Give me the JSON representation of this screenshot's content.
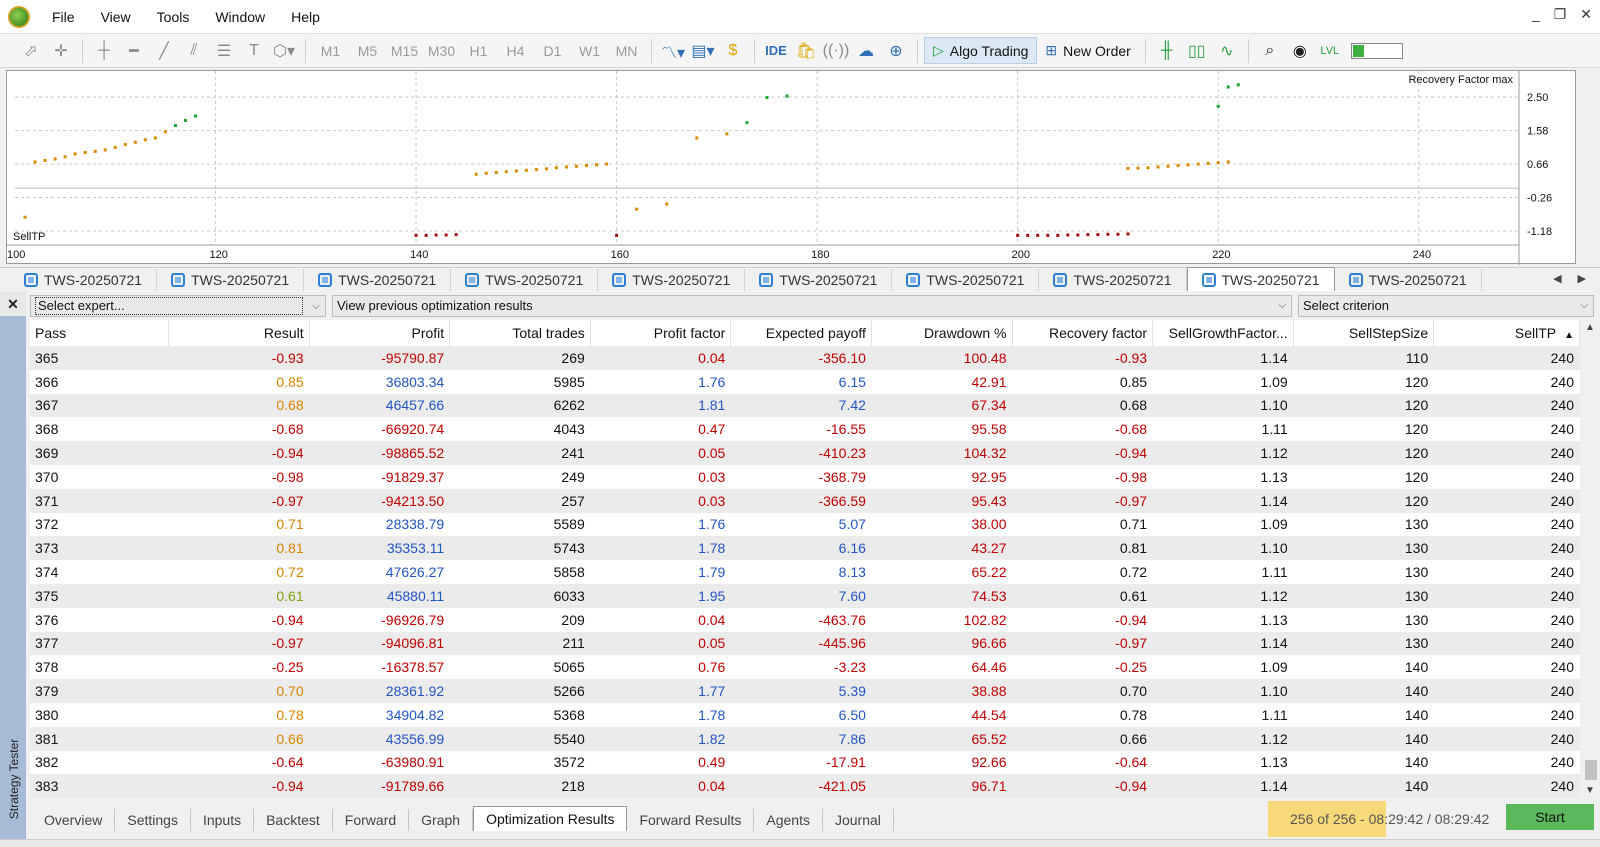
{
  "menu": [
    "File",
    "View",
    "Tools",
    "Window",
    "Help"
  ],
  "window_controls": [
    "_",
    "❐",
    "✕"
  ],
  "toolbar": {
    "timeframes": [
      "M1",
      "M5",
      "M15",
      "M30",
      "H1",
      "H4",
      "D1",
      "W1",
      "MN"
    ],
    "ide_label": "IDE",
    "algo_trading_label": "Algo Trading",
    "new_order_label": "New Order",
    "level_fraction": 0.22
  },
  "chart": {
    "param_label": "SellTP",
    "criterion_label": "Recovery Factor max"
  },
  "chart_data": {
    "type": "scatter",
    "title": "",
    "xlabel": "SellTP",
    "ylabel": "Recovery Factor max",
    "xlim": [
      100,
      250
    ],
    "ylim": [
      -1.4,
      3.0
    ],
    "x_ticks": [
      "100",
      "120",
      "140",
      "160",
      "180",
      "200",
      "220",
      "240"
    ],
    "y_ticks": [
      "2.50",
      "1.58",
      "0.66",
      "-0.26",
      "-1.18"
    ],
    "grid": true,
    "point_colors": {
      "high": "#19a630",
      "mid": "#d98a00",
      "low": "#a01010"
    },
    "points": [
      [
        101,
        -0.8
      ],
      [
        102,
        0.72
      ],
      [
        103,
        0.76
      ],
      [
        104,
        0.8
      ],
      [
        105,
        0.86
      ],
      [
        106,
        0.94
      ],
      [
        107,
        0.98
      ],
      [
        108,
        1.01
      ],
      [
        109,
        1.05
      ],
      [
        110,
        1.12
      ],
      [
        111,
        1.2
      ],
      [
        112,
        1.26
      ],
      [
        113,
        1.33
      ],
      [
        114,
        1.38
      ],
      [
        115,
        1.55
      ],
      [
        116,
        1.72
      ],
      [
        117,
        1.86
      ],
      [
        118,
        1.98
      ],
      [
        140,
        -1.3
      ],
      [
        141,
        -1.3
      ],
      [
        142,
        -1.29
      ],
      [
        143,
        -1.29
      ],
      [
        144,
        -1.28
      ],
      [
        146,
        0.38
      ],
      [
        147,
        0.41
      ],
      [
        148,
        0.43
      ],
      [
        149,
        0.45
      ],
      [
        150,
        0.47
      ],
      [
        151,
        0.49
      ],
      [
        152,
        0.51
      ],
      [
        153,
        0.53
      ],
      [
        154,
        0.56
      ],
      [
        155,
        0.58
      ],
      [
        156,
        0.6
      ],
      [
        157,
        0.62
      ],
      [
        158,
        0.64
      ],
      [
        159,
        0.66
      ],
      [
        160,
        -1.3
      ],
      [
        162,
        -0.58
      ],
      [
        165,
        -0.44
      ],
      [
        168,
        1.38
      ],
      [
        171,
        1.49
      ],
      [
        173,
        1.8
      ],
      [
        175,
        2.49
      ],
      [
        177,
        2.53
      ],
      [
        200,
        -1.3
      ],
      [
        201,
        -1.3
      ],
      [
        202,
        -1.3
      ],
      [
        203,
        -1.3
      ],
      [
        204,
        -1.3
      ],
      [
        205,
        -1.29
      ],
      [
        206,
        -1.29
      ],
      [
        207,
        -1.28
      ],
      [
        208,
        -1.28
      ],
      [
        209,
        -1.27
      ],
      [
        210,
        -1.27
      ],
      [
        211,
        -1.26
      ],
      [
        211,
        0.54
      ],
      [
        212,
        0.55
      ],
      [
        213,
        0.56
      ],
      [
        214,
        0.58
      ],
      [
        215,
        0.6
      ],
      [
        216,
        0.62
      ],
      [
        217,
        0.64
      ],
      [
        218,
        0.66
      ],
      [
        219,
        0.68
      ],
      [
        220,
        0.7
      ],
      [
        221,
        0.72
      ],
      [
        220,
        2.25
      ],
      [
        221,
        2.78
      ],
      [
        222,
        2.84
      ]
    ]
  },
  "chart_tabs": {
    "labels": [
      "TWS-20250721",
      "TWS-20250721",
      "TWS-20250721",
      "TWS-20250721",
      "TWS-20250721",
      "TWS-20250721",
      "TWS-20250721",
      "TWS-20250721",
      "TWS-20250721",
      "TWS-20250721"
    ],
    "active_index": 8
  },
  "tester": {
    "side_label": "Strategy Tester",
    "close_label": "✕",
    "expert_select": "Select expert...",
    "results_select": "View previous optimization results",
    "criterion_select": "Select criterion",
    "columns": [
      "Pass",
      "Result",
      "Profit",
      "Total trades",
      "Profit factor",
      "Expected payoff",
      "Drawdown %",
      "Recovery factor",
      "SellGrowthFactor...",
      "SellStepSize",
      "SellTP"
    ],
    "sort_indicator": "▲",
    "rows": [
      [
        "365",
        "-0.93",
        "-95790.87",
        "269",
        "0.04",
        "-356.10",
        "100.48",
        "-0.93",
        "1.14",
        "110",
        "240"
      ],
      [
        "366",
        "0.85",
        "36803.34",
        "5985",
        "1.76",
        "6.15",
        "42.91",
        "0.85",
        "1.09",
        "120",
        "240"
      ],
      [
        "367",
        "0.68",
        "46457.66",
        "6262",
        "1.81",
        "7.42",
        "67.34",
        "0.68",
        "1.10",
        "120",
        "240"
      ],
      [
        "368",
        "-0.68",
        "-66920.74",
        "4043",
        "0.47",
        "-16.55",
        "95.58",
        "-0.68",
        "1.11",
        "120",
        "240"
      ],
      [
        "369",
        "-0.94",
        "-98865.52",
        "241",
        "0.05",
        "-410.23",
        "104.32",
        "-0.94",
        "1.12",
        "120",
        "240"
      ],
      [
        "370",
        "-0.98",
        "-91829.37",
        "249",
        "0.03",
        "-368.79",
        "92.95",
        "-0.98",
        "1.13",
        "120",
        "240"
      ],
      [
        "371",
        "-0.97",
        "-94213.50",
        "257",
        "0.03",
        "-366.59",
        "95.43",
        "-0.97",
        "1.14",
        "120",
        "240"
      ],
      [
        "372",
        "0.71",
        "28338.79",
        "5589",
        "1.76",
        "5.07",
        "38.00",
        "0.71",
        "1.09",
        "130",
        "240"
      ],
      [
        "373",
        "0.81",
        "35353.11",
        "5743",
        "1.78",
        "6.16",
        "43.27",
        "0.81",
        "1.10",
        "130",
        "240"
      ],
      [
        "374",
        "0.72",
        "47626.27",
        "5858",
        "1.79",
        "8.13",
        "65.22",
        "0.72",
        "1.11",
        "130",
        "240"
      ],
      [
        "375",
        "0.61",
        "45880.11",
        "6033",
        "1.95",
        "7.60",
        "74.53",
        "0.61",
        "1.12",
        "130",
        "240"
      ],
      [
        "376",
        "-0.94",
        "-96926.79",
        "209",
        "0.04",
        "-463.76",
        "102.82",
        "-0.94",
        "1.13",
        "130",
        "240"
      ],
      [
        "377",
        "-0.97",
        "-94096.81",
        "211",
        "0.05",
        "-445.96",
        "96.66",
        "-0.97",
        "1.14",
        "130",
        "240"
      ],
      [
        "378",
        "-0.25",
        "-16378.57",
        "5065",
        "0.76",
        "-3.23",
        "64.46",
        "-0.25",
        "1.09",
        "140",
        "240"
      ],
      [
        "379",
        "0.70",
        "28361.92",
        "5266",
        "1.77",
        "5.39",
        "38.88",
        "0.70",
        "1.10",
        "140",
        "240"
      ],
      [
        "380",
        "0.78",
        "34904.82",
        "5368",
        "1.78",
        "6.50",
        "44.54",
        "0.78",
        "1.11",
        "140",
        "240"
      ],
      [
        "381",
        "0.66",
        "43556.99",
        "5540",
        "1.82",
        "7.86",
        "65.52",
        "0.66",
        "1.12",
        "140",
        "240"
      ],
      [
        "382",
        "-0.64",
        "-63980.91",
        "3572",
        "0.49",
        "-17.91",
        "92.66",
        "-0.64",
        "1.13",
        "140",
        "240"
      ],
      [
        "383",
        "-0.94",
        "-91789.66",
        "218",
        "0.04",
        "-421.05",
        "96.71",
        "-0.94",
        "1.14",
        "140",
        "240"
      ]
    ],
    "bottom_tabs": [
      "Overview",
      "Settings",
      "Inputs",
      "Backtest",
      "Forward",
      "Graph",
      "Optimization Results",
      "Forward Results",
      "Agents",
      "Journal"
    ],
    "active_bottom_tab": 6,
    "progress_text": "256 of 256  -  08:29:42 / 08:29:42",
    "start_label": "Start"
  }
}
